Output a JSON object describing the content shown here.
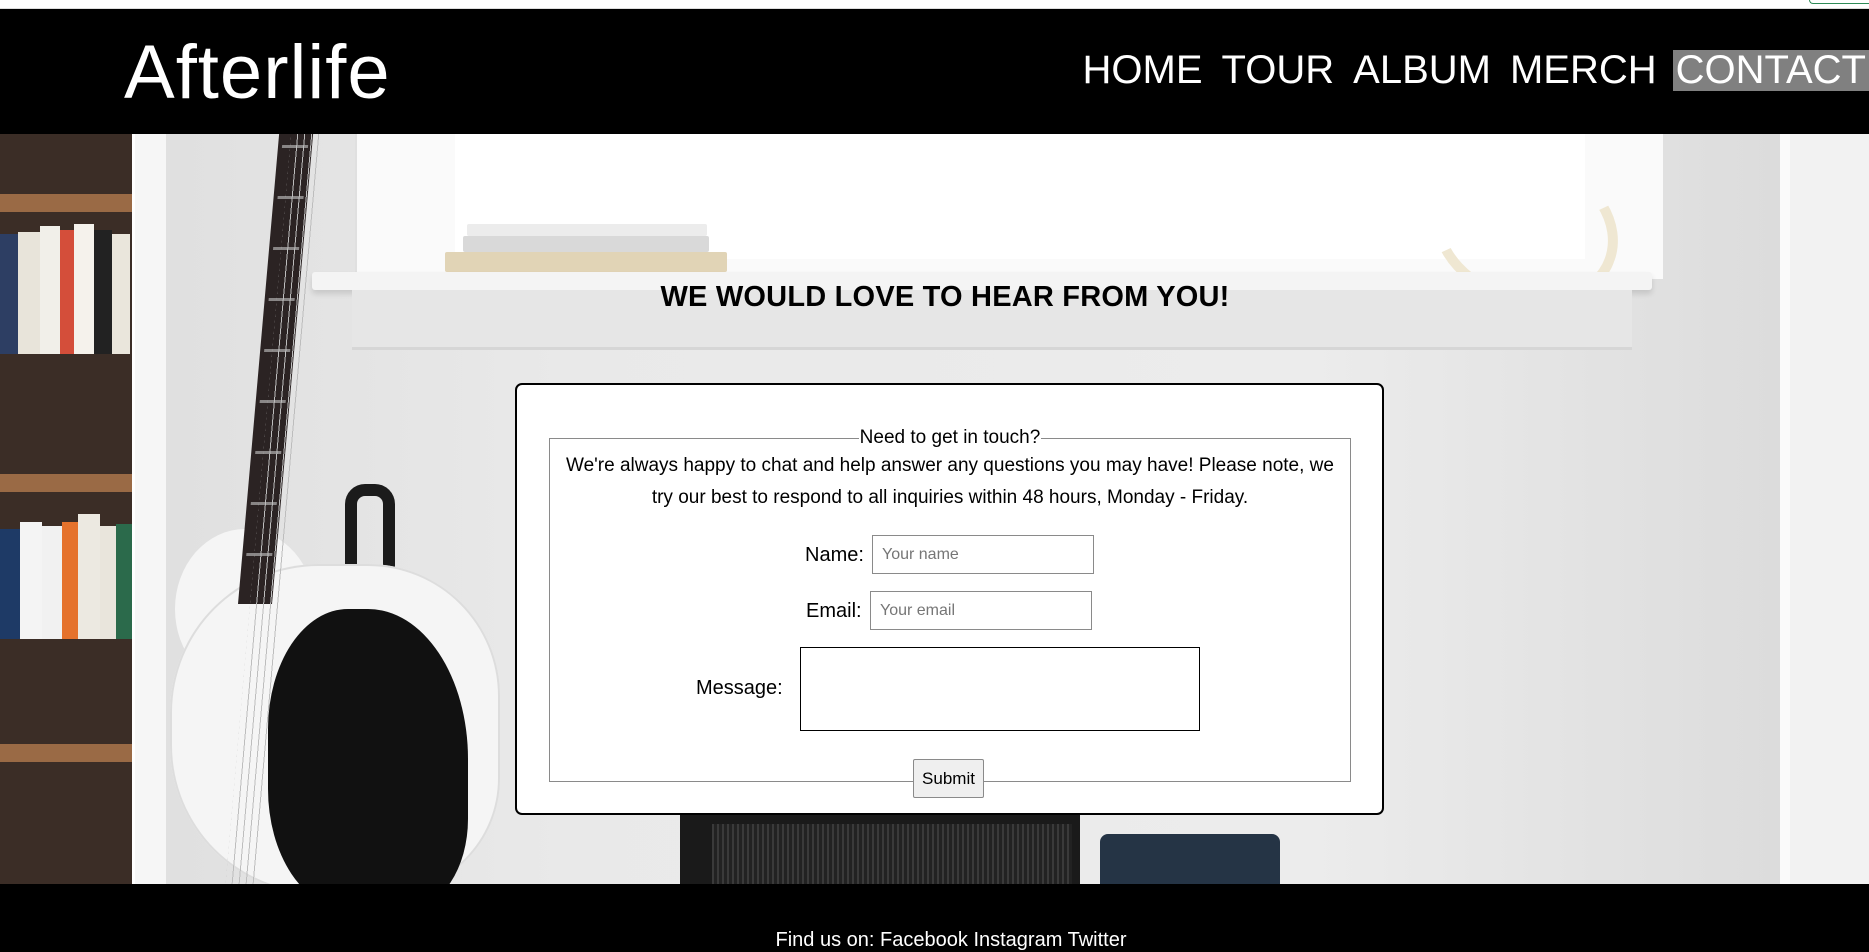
{
  "header": {
    "logo": "Afterlife",
    "nav": [
      "HOME",
      "TOUR",
      "ALBUM",
      "MERCH",
      "CONTACT"
    ],
    "active_nav": "CONTACT"
  },
  "main": {
    "heading": "WE WOULD LOVE TO HEAR FROM YOU!",
    "form": {
      "legend": "Need to get in touch?",
      "intro": "We're always happy to chat and help answer any questions you may have! Please note, we try our best to respond to all inquiries within 48 hours, Monday - Friday.",
      "name_label": "Name:",
      "name_placeholder": "Your name",
      "name_value": "",
      "email_label": "Email:",
      "email_placeholder": "Your email",
      "email_value": "",
      "message_label": "Message:",
      "message_value": "",
      "submit_label": "Submit"
    }
  },
  "footer": {
    "prefix": "Find us on:",
    "links": [
      "Facebook",
      "Instagram",
      "Twitter"
    ]
  },
  "colors": {
    "header_bg": "#000000",
    "active_nav_bg": "#808080",
    "footer_bg": "#000000"
  }
}
